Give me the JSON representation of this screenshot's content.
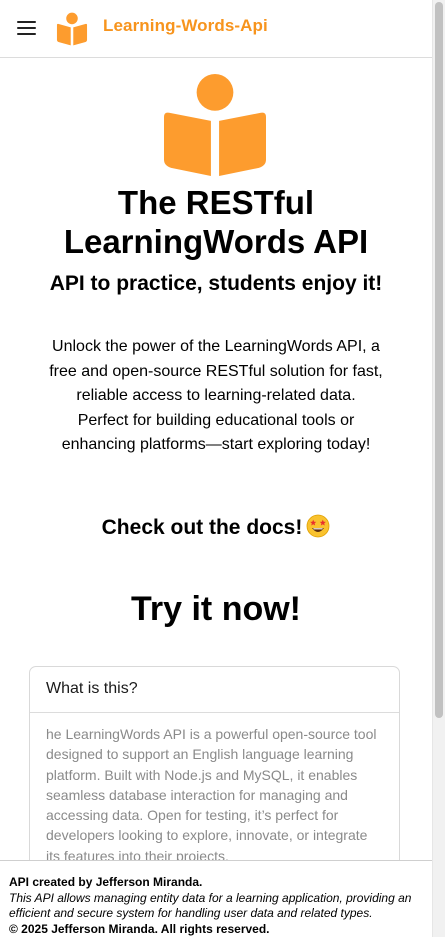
{
  "header": {
    "brand_name": "Learning-Words-Api",
    "menu_icon": "hamburger-menu-icon",
    "logo_icon": "book-reader-icon"
  },
  "hero": {
    "logo_icon": "book-reader-icon",
    "title": "The RESTful LearningWords API",
    "subtitle": "API to practice, students enjoy it!"
  },
  "intro": {
    "paragraph_1": "Unlock the power of the LearningWords API, a free and open-source RESTful solution for fast, reliable access to learning-related data.",
    "paragraph_2": "Perfect for building educational tools or enhancing platforms—start exploring today!"
  },
  "docs": {
    "label": "Check out the docs!",
    "emoji_icon": "star-struck-emoji-icon"
  },
  "try_now": {
    "label": "Try it now!"
  },
  "card": {
    "title": "What is this?",
    "body": "he LearningWords API is a powerful open-source tool designed to support an English language learning platform. Built with Node.js and MySQL, it enables seamless database interaction for managing and accessing data. Open for testing, it’s perfect for developers looking to explore, innovate, or integrate its features into their projects."
  },
  "footer": {
    "credit": "API created by Jefferson Miranda.",
    "description": "This API allows managing entity data for a learning application, providing an efficient and secure system for handling user data and related types.",
    "copyright": "© 2025 Jefferson Miranda. All rights reserved."
  },
  "colors": {
    "brand_orange": "#f7941d",
    "logo_orange": "#fd9c2e"
  }
}
